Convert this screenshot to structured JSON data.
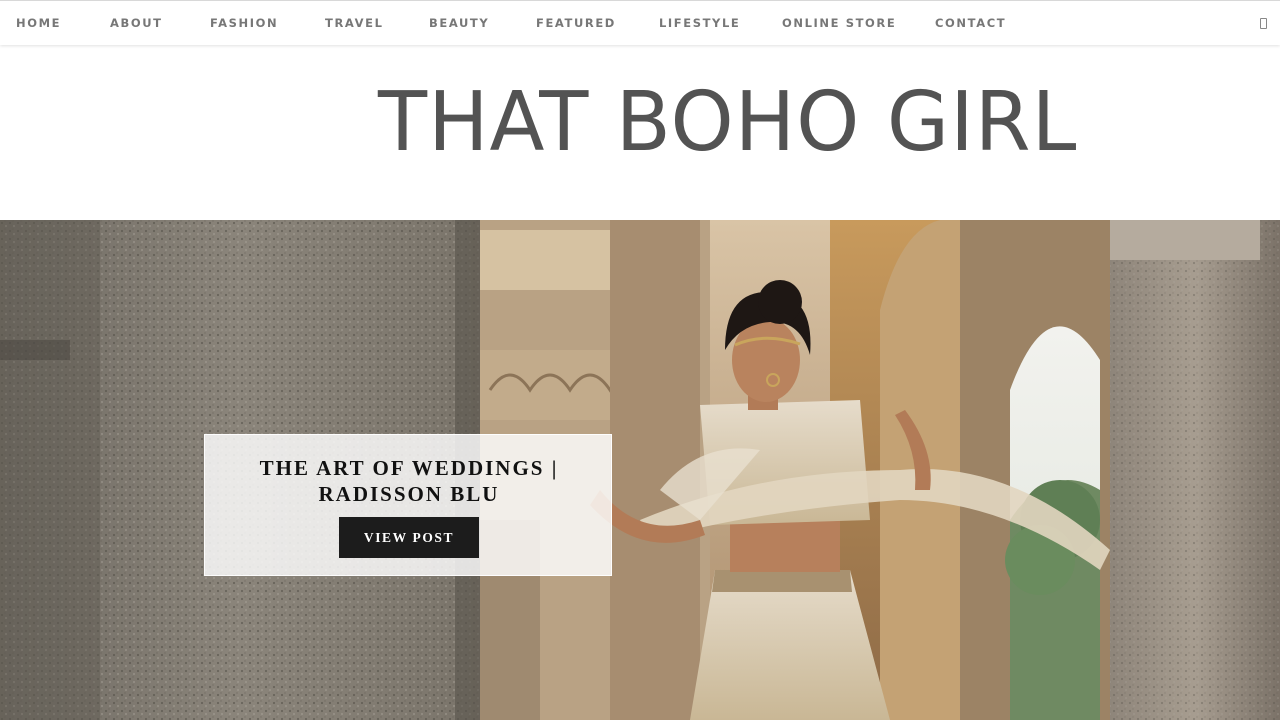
{
  "nav": {
    "items": [
      "HOME",
      "ABOUT",
      "FASHION",
      "TRAVEL",
      "BEAUTY",
      "FEATURED",
      "LIFESTYLE",
      "ONLINE STORE",
      "CONTACT"
    ],
    "menu_icon": "mobile-menu-icon"
  },
  "header": {
    "logo_text": "THAT BOHO GIRL"
  },
  "hero": {
    "post_title_line1": "THE ART OF WEDDINGS |",
    "post_title_line2": "RADISSON BLU",
    "button_label": "VIEW POST"
  },
  "colors": {
    "nav_text": "#777777",
    "logo": "#535353",
    "button_bg": "#1c1c1c",
    "button_text": "#ffffff"
  }
}
